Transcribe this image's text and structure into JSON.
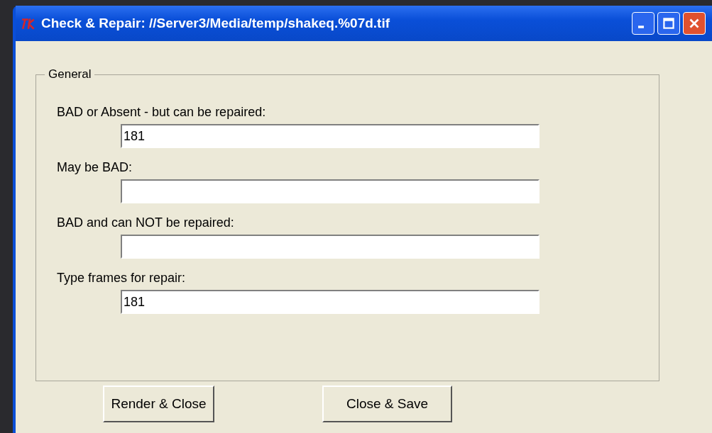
{
  "window": {
    "title": "Check & Repair: //Server3/Media/temp/shakeq.%07d.tif"
  },
  "group": {
    "title": "General",
    "fields": [
      {
        "label": "BAD or Absent - but can be repaired:",
        "value": "181"
      },
      {
        "label": "May be BAD:"
      },
      {
        "label": "BAD and can NOT be repaired:"
      },
      {
        "label": "Type frames for repair:",
        "value": "181"
      }
    ]
  },
  "buttons": [
    "Render & Close",
    "Close & Save"
  ]
}
